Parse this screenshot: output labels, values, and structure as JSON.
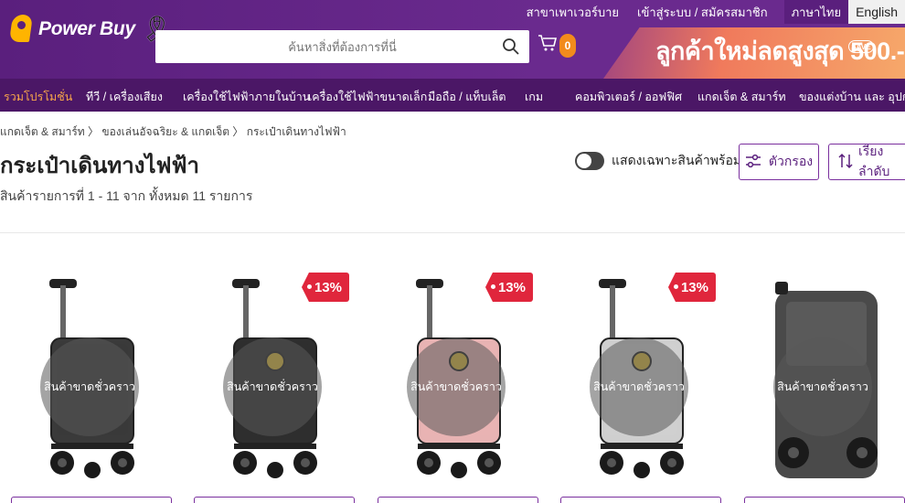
{
  "header": {
    "brand": "Power Buy",
    "ribbon": "🎗",
    "search_placeholder": "ค้นหาสิ่งที่ต้องการที่นี่",
    "cart_count": "0",
    "top_links": [
      "สาขาเพาเวอร์บาย",
      "เข้าสู่ระบบ / สมัครสมาชิก"
    ],
    "lang_th": "ภาษาไทย",
    "lang_en": "English",
    "promo": "ลูกค้าใหม่ลดสูงสุด 500.-",
    "promo_tag": "SAVE",
    "colors": {
      "primary": "#5a1f7d",
      "nav": "#4b1766",
      "accent": "#f6a44b",
      "badge": "#f28b1c"
    }
  },
  "nav": [
    {
      "label": "รวมโปรโมชั่น"
    },
    {
      "label": "ทีวี / เครื่องเสียง"
    },
    {
      "label": "เครื่องใช้ไฟฟ้าภายในบ้าน"
    },
    {
      "label": "เครื่องใช้ไฟฟ้าขนาดเล็ก"
    },
    {
      "label": "มือถือ / แท็บเล็ต"
    },
    {
      "label": "เกม"
    },
    {
      "label": "คอมพิวเตอร์ / ออฟฟิศ"
    },
    {
      "label": "แกดเจ็ต & สมาร์ท"
    },
    {
      "label": "ของแต่งบ้าน และ อุปกรณ์"
    }
  ],
  "page": {
    "breadcrumb": "แกดเจ็ต & สมาร์ท 〉 ของเล่นอัจฉริยะ & แกดเจ็ต 〉 กระเป๋าเดินทางไฟฟ้า",
    "title": "กระเป๋าเดินทางไฟฟ้า",
    "result_count": "สินค้ารายการที่ 1 - 11 จาก ทั้งหมด 11 รายการ",
    "stock_toggle_label": "แสดงเฉพาะสินค้าพร้อมส่ง",
    "filter_label": "ตัวกรอง",
    "sort_label": "เรียงลำดับ"
  },
  "products": [
    {
      "oos_label": "สินค้าขาดชั่วคราว",
      "discount": "",
      "color": "#3a3a3a"
    },
    {
      "oos_label": "สินค้าขาดชั่วคราว",
      "discount": "13%",
      "color": "#2e2e2e"
    },
    {
      "oos_label": "สินค้าขาดชั่วคราว",
      "discount": "13%",
      "color": "#e8b3b3"
    },
    {
      "oos_label": "สินค้าขาดชั่วคราว",
      "discount": "13%",
      "color": "#cfcfcf"
    },
    {
      "oos_label": "สินค้าขาดชั่วคราว",
      "discount": "",
      "color": "#4a4a4a"
    }
  ]
}
